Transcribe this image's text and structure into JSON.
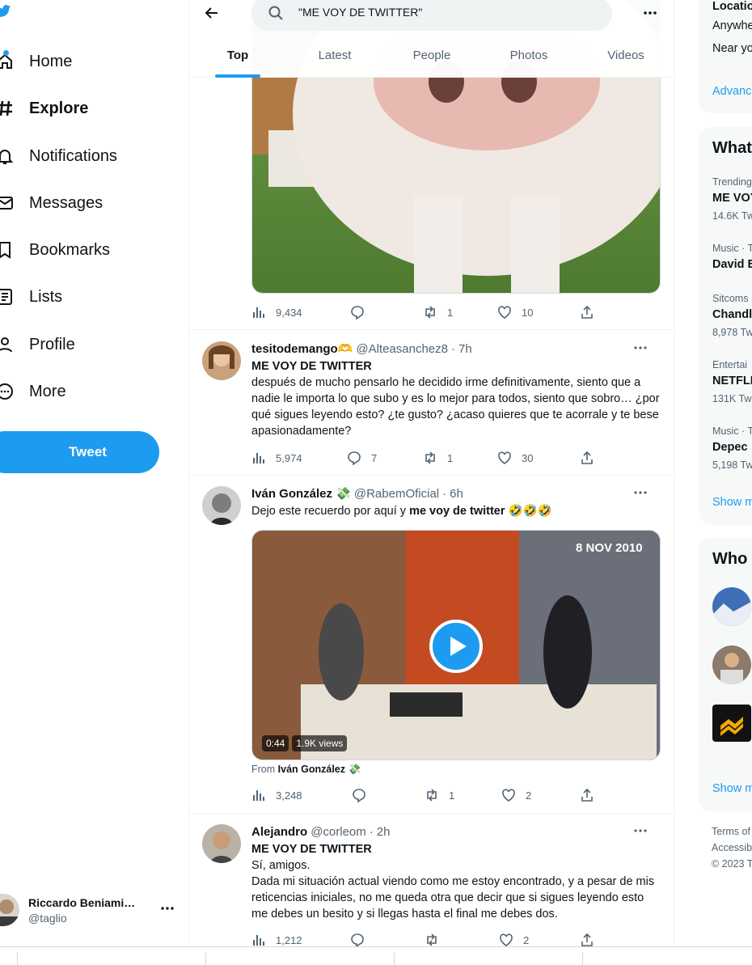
{
  "nav": {
    "items": [
      {
        "label": "Home",
        "icon": "home-icon"
      },
      {
        "label": "Explore",
        "icon": "hashtag-icon"
      },
      {
        "label": "Notifications",
        "icon": "bell-icon"
      },
      {
        "label": "Messages",
        "icon": "envelope-icon"
      },
      {
        "label": "Bookmarks",
        "icon": "bookmark-icon"
      },
      {
        "label": "Lists",
        "icon": "list-icon"
      },
      {
        "label": "Profile",
        "icon": "person-icon"
      },
      {
        "label": "More",
        "icon": "more-circle-icon"
      }
    ],
    "tweet_label": "Tweet",
    "account": {
      "name": "Riccardo Beniami…",
      "handle": "@taglio"
    }
  },
  "search": {
    "query": "\"ME VOY DE TWITTER\""
  },
  "tabs": [
    "Top",
    "Latest",
    "People",
    "Photos",
    "Videos"
  ],
  "posts": [
    {
      "stats": {
        "views": "9,434",
        "replies": "",
        "retweets": "1",
        "likes": "10"
      }
    },
    {
      "name": "tesitodemango🫶",
      "handle": "@Alteasanchez8",
      "time": "7h",
      "title": "ME VOY DE TWITTER",
      "text": "después de mucho pensarlo he decidido irme definitivamente, siento que a nadie le importa lo que subo y es lo mejor para todos, siento que sobro… ¿por qué sigues leyendo esto? ¿te gusto? ¿acaso quieres que te acorrale y te bese apasionadamente?",
      "stats": {
        "views": "5,974",
        "replies": "7",
        "retweets": "1",
        "likes": "30"
      }
    },
    {
      "name": "Iván González 💸",
      "handle": "@RabemOficial",
      "time": "6h",
      "text_prefix": "Dejo este recuerdo por aquí y ",
      "text_bold": "me voy de twitter",
      "text_suffix": " 🤣🤣🤣",
      "video": {
        "duration": "0:44",
        "views": "1.9K views",
        "date_overlay": "8 NOV 2010"
      },
      "from_label": "From",
      "from_name": "Iván González 💸",
      "stats": {
        "views": "3,248",
        "replies": "",
        "retweets": "1",
        "likes": "2"
      }
    },
    {
      "name": "Alejandro",
      "handle": "@corleom",
      "time": "2h",
      "title": "ME VOY DE TWITTER",
      "line1": "Sí, amigos.",
      "text": "Dada mi situación actual viendo como me estoy encontrado, y a pesar de mis reticencias iniciales, no me queda otra que decir que si sigues leyendo esto me debes un besito y si llegas hasta el final me debes dos.",
      "stats": {
        "views": "1,212",
        "replies": "",
        "retweets": "",
        "likes": "2"
      }
    }
  ],
  "right": {
    "location": {
      "title": "Locatio",
      "opt1": "Anywhe",
      "opt2": "Near yo",
      "advanced": "Advanc"
    },
    "trends": {
      "title": "What",
      "items": [
        {
          "context": "Trending",
          "name": "ME VOY",
          "count": "14.6K Tw"
        },
        {
          "context": "Music · T",
          "name": "David B",
          "count": ""
        },
        {
          "context": "Sitcoms",
          "name": "Chandl",
          "count": "8,978 Tw"
        },
        {
          "context": "Entertai",
          "name": "NETFLI",
          "count": "131K Twe"
        },
        {
          "context": "Music · T",
          "name": "Depec",
          "count": "5,198 Tw"
        }
      ],
      "show_more": "Show m"
    },
    "who": {
      "title": "Who",
      "show_more": "Show m"
    },
    "footer": {
      "line1": "Terms of",
      "line2": "Accessib",
      "line3": "© 2023 T"
    }
  },
  "colors": {
    "accent": "#1d9bf0",
    "text": "#0f1419",
    "muted": "#536471",
    "border": "#eff3f4"
  }
}
